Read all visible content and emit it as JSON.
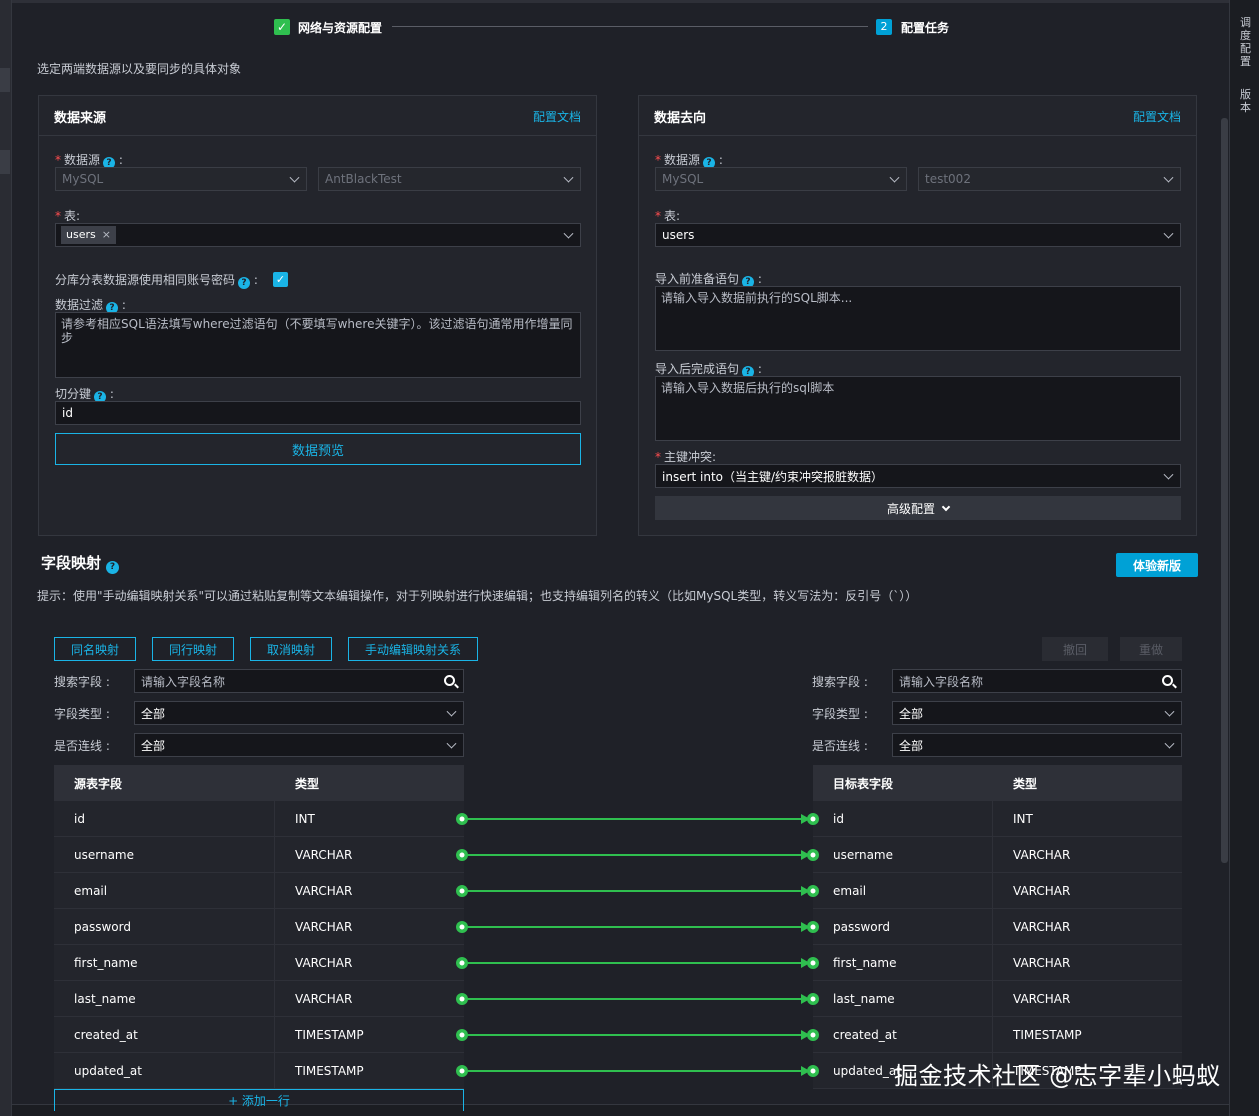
{
  "steps": [
    {
      "label": "网络与资源配置",
      "status": "done"
    },
    {
      "label": "配置任务",
      "number": "2",
      "status": "active"
    }
  ],
  "description": "选定两端数据源以及要同步的具体对象",
  "right_sidebar": {
    "item1": "调度配置",
    "item2": "版本"
  },
  "source": {
    "title": "数据来源",
    "doc_link": "配置文档",
    "datasource_label": "数据源",
    "datasource_type": "MySQL",
    "datasource_name": "AntBlackTest",
    "table_label": "表:",
    "table_tag": "users",
    "same_account_label": "分库分表数据源使用相同账号密码",
    "filter_label": "数据过滤",
    "filter_placeholder": "请参考相应SQL语法填写where过滤语句（不要填写where关键字）。该过滤语句通常用作增量同步",
    "split_key_label": "切分键",
    "split_key_value": "id",
    "preview_button": "数据预览"
  },
  "target": {
    "title": "数据去向",
    "doc_link": "配置文档",
    "datasource_label": "数据源",
    "datasource_type": "MySQL",
    "datasource_name": "test002",
    "table_label": "表:",
    "table_value": "users",
    "pre_sql_label": "导入前准备语句",
    "pre_sql_placeholder": "请输入导入数据前执行的SQL脚本...",
    "post_sql_label": "导入后完成语句",
    "post_sql_placeholder": "请输入导入数据后执行的sql脚本",
    "conflict_label": "主键冲突:",
    "conflict_value": "insert into（当主键/约束冲突报脏数据）",
    "advanced_button": "高级配置"
  },
  "mapping": {
    "title": "字段映射",
    "new_version_button": "体验新版",
    "hint": "提示：使用\"手动编辑映射关系\"可以通过粘贴复制等文本编辑操作，对于列映射进行快速编辑；也支持编辑列名的转义（比如MySQL类型，转义写法为：反引号（`））",
    "buttons": [
      "同名映射",
      "同行映射",
      "取消映射",
      "手动编辑映射关系"
    ],
    "undo": "撤回",
    "redo": "重做",
    "left_filters": {
      "search_label": "搜索字段 :",
      "search_placeholder": "请输入字段名称",
      "type_label": "字段类型 :",
      "type_value": "全部",
      "linked_label": "是否连线 :",
      "linked_value": "全部"
    },
    "right_filters": {
      "search_label": "搜索字段 :",
      "search_placeholder": "请输入字段名称",
      "type_label": "字段类型 :",
      "type_value": "全部",
      "linked_label": "是否连线 :",
      "linked_value": "全部"
    },
    "source_headers": [
      "源表字段",
      "类型"
    ],
    "target_headers": [
      "目标表字段",
      "类型"
    ],
    "source_rows": [
      [
        "id",
        "INT"
      ],
      [
        "username",
        "VARCHAR"
      ],
      [
        "email",
        "VARCHAR"
      ],
      [
        "password",
        "VARCHAR"
      ],
      [
        "first_name",
        "VARCHAR"
      ],
      [
        "last_name",
        "VARCHAR"
      ],
      [
        "created_at",
        "TIMESTAMP"
      ],
      [
        "updated_at",
        "TIMESTAMP"
      ]
    ],
    "target_rows": [
      [
        "id",
        "INT"
      ],
      [
        "username",
        "VARCHAR"
      ],
      [
        "email",
        "VARCHAR"
      ],
      [
        "password",
        "VARCHAR"
      ],
      [
        "first_name",
        "VARCHAR"
      ],
      [
        "last_name",
        "VARCHAR"
      ],
      [
        "created_at",
        "TIMESTAMP"
      ],
      [
        "updated_at",
        "TIMESTAMP"
      ]
    ],
    "add_row": "+ 添加一行"
  },
  "colors": {
    "accent": "#1ab4e6",
    "link_line": "#2fbf4f",
    "required": "#ff4d4f"
  },
  "watermark": "掘金技术社区 @志字辈小蚂蚁"
}
